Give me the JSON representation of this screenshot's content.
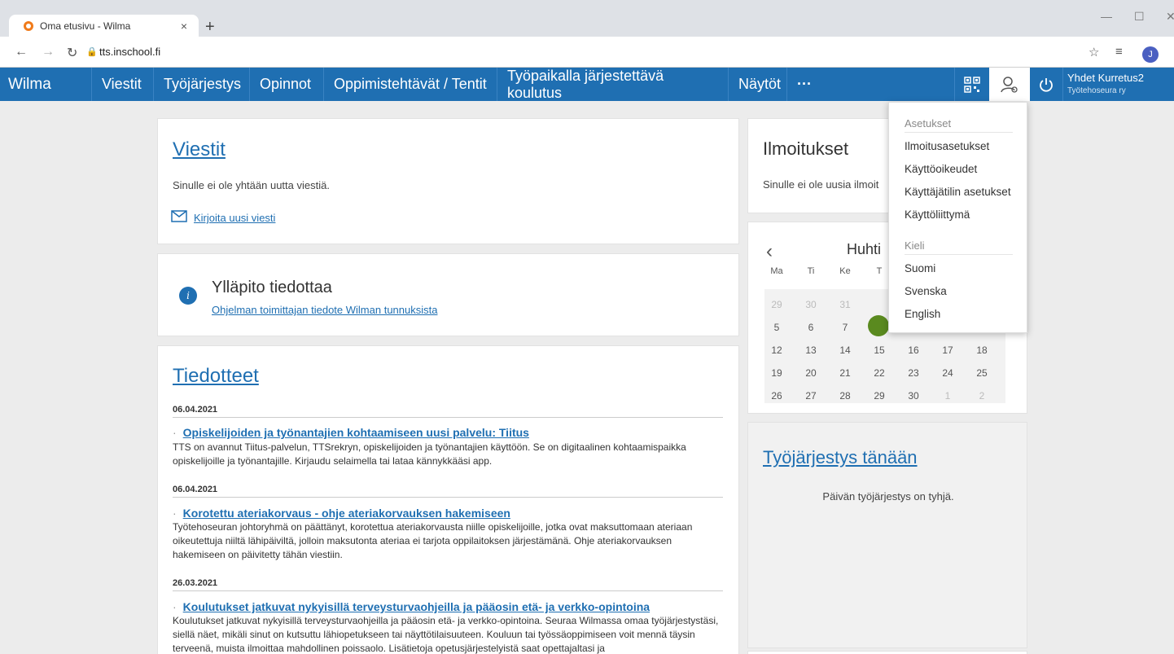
{
  "browser": {
    "tab_title": "Oma etusivu - Wilma",
    "tab_close": "×",
    "new_tab": "+",
    "url": "tts.inschool.fi",
    "profile_initial": "J"
  },
  "nav": {
    "brand": "Wilma",
    "items": [
      "Viestit",
      "Työjärjestys",
      "Opinnot",
      "Oppimistehtävät / Tentit",
      "Työpaikalla järjestettävä koulutus",
      "Näytöt"
    ],
    "more": "···",
    "user_name": "Yhdet Kurretus2",
    "user_org": "Työtehoseura ry"
  },
  "messages": {
    "title": "Viestit",
    "empty_text": "Sinulle ei ole yhtään uutta viestiä.",
    "new_message_link": "Kirjoita uusi viesti"
  },
  "maintenance": {
    "title": "Ylläpito tiedottaa",
    "link": "Ohjelman toimittajan tiedote Wilman tunnuksista",
    "icon_letter": "i"
  },
  "news": {
    "title": "Tiedotteet",
    "items": [
      {
        "date": "06.04.2021",
        "heading": "Opiskelijoiden ja työnantajien kohtaamiseen uusi palvelu: Tiitus",
        "body": "TTS on avannut Tiitus-palvelun, TTSrekryn, opiskelijoiden ja työnantajien käyttöön. Se on digitaalinen kohtaamispaikka opiskelijoille ja työnantajille. Kirjaudu selaimella tai lataa kännykkääsi app."
      },
      {
        "date": "06.04.2021",
        "heading": "Korotettu ateriakorvaus - ohje ateriakorvauksen hakemiseen",
        "body": "Työtehoseuran johtoryhmä on päättänyt, korotettua ateriakorvausta niille opiskelijoille, jotka ovat maksuttomaan ateriaan oikeutettuja niiltä lähipäiviltä, jolloin maksutonta ateriaa ei tarjota oppilaitoksen järjestämänä. Ohje ateriakorvauksen hakemiseen on päivitetty tähän viestiin."
      },
      {
        "date": "26.03.2021",
        "heading": "Koulutukset jatkuvat nykyisillä terveysturvaohjeilla ja pääosin etä- ja verkko-opintoina",
        "body": "Koulutukset jatkuvat nykyisillä terveysturvaohjeilla ja pääosin etä- ja verkko-opintoina. Seuraa Wilmassa omaa työjärjestystäsi, siellä näet, mikäli sinut on kutsuttu lähiopetukseen tai näyttötilaisuuteen. Kouluun tai työssäoppimiseen voit mennä täysin terveenä, muista ilmoittaa mahdollinen poissaolo. Lisätietoja opetusjärjestelyistä saat opettajaltasi ja"
      }
    ]
  },
  "notices": {
    "title": "Ilmoitukset",
    "empty_text": "Sinulle ei ole uusia ilmoit"
  },
  "calendar": {
    "prev": "‹",
    "month": "Huhti",
    "weekdays": [
      "Ma",
      "Ti",
      "Ke",
      "T"
    ],
    "rows": [
      [
        "29",
        "30",
        "31",
        "",
        "",
        "",
        ""
      ],
      [
        "5",
        "6",
        "7",
        "",
        "",
        "",
        ""
      ],
      [
        "12",
        "13",
        "14",
        "15",
        "16",
        "17",
        "18"
      ],
      [
        "19",
        "20",
        "21",
        "22",
        "23",
        "24",
        "25"
      ],
      [
        "26",
        "27",
        "28",
        "29",
        "30",
        "1",
        "2"
      ]
    ],
    "today_color": "#5a8a1f"
  },
  "schedule": {
    "title": "Työjärjestys tänään",
    "empty_text": "Päivän työjärjestys on tyhjä."
  },
  "dropdown": {
    "settings_header": "Asetukset",
    "settings_items": [
      "Ilmoitusasetukset",
      "Käyttöoikeudet",
      "Käyttäjätilin asetukset",
      "Käyttöliittymä"
    ],
    "language_header": "Kieli",
    "language_items": [
      "Suomi",
      "Svenska",
      "English"
    ]
  },
  "colors": {
    "nav_bg": "#1f6fb2",
    "link": "#1f6fb2",
    "page_bg": "#ececec"
  }
}
